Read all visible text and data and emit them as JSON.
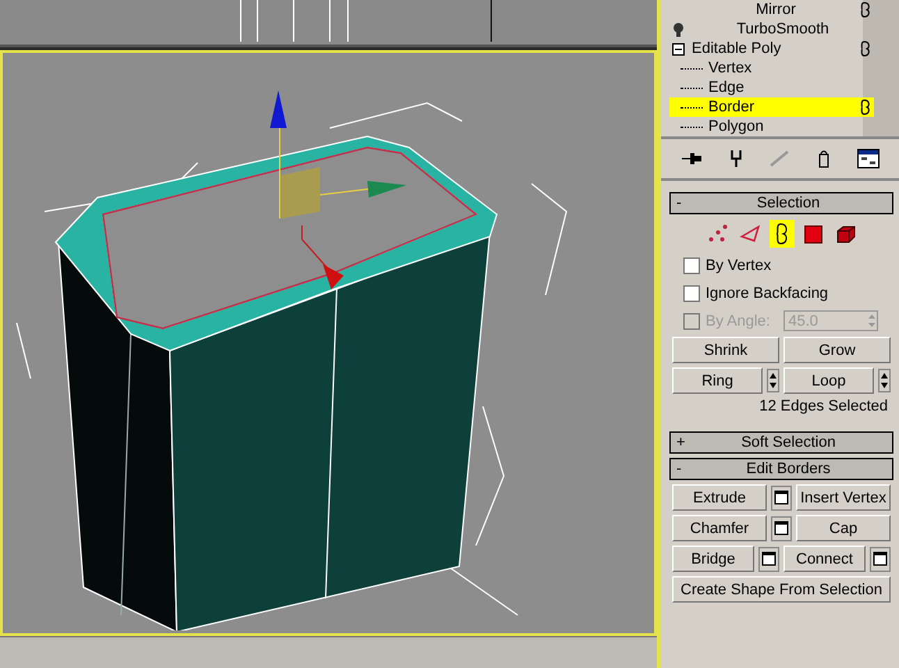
{
  "modifier_stack": [
    {
      "label": "Mirror",
      "kind": "modifier",
      "mode_icon": true,
      "selected": false
    },
    {
      "label": "TurboSmooth",
      "kind": "modifier",
      "mode_icon": false,
      "selected": false
    },
    {
      "label": "Editable Poly",
      "kind": "object",
      "mode_icon": true,
      "selected": false,
      "expanded": true,
      "children": [
        {
          "label": "Vertex",
          "mode_icon": false,
          "selected": false
        },
        {
          "label": "Edge",
          "mode_icon": false,
          "selected": false
        },
        {
          "label": "Border",
          "mode_icon": true,
          "selected": true
        },
        {
          "label": "Polygon",
          "mode_icon": false,
          "selected": false
        }
      ]
    }
  ],
  "selection": {
    "title": "Selection",
    "collapse_sign": "-",
    "levels": [
      {
        "kind": "vertex",
        "selected": false
      },
      {
        "kind": "edge",
        "selected": false
      },
      {
        "kind": "border",
        "selected": true
      },
      {
        "kind": "polygon",
        "selected": false
      },
      {
        "kind": "element",
        "selected": false
      }
    ],
    "options": [
      {
        "label": "By Vertex",
        "checked": false,
        "disabled": false
      },
      {
        "label": "Ignore Backfacing",
        "checked": false,
        "disabled": false
      },
      {
        "label": "By Angle:",
        "checked": false,
        "disabled": true,
        "value": "45.0"
      }
    ],
    "buttons": [
      [
        {
          "label": "Shrink",
          "spinner": false
        },
        {
          "label": "Grow",
          "spinner": false
        }
      ],
      [
        {
          "label": "Ring",
          "spinner": true
        },
        {
          "label": "Loop",
          "spinner": true
        }
      ]
    ],
    "status": "12 Edges Selected"
  },
  "soft_selection": {
    "title": "Soft Selection",
    "collapse_sign": "+"
  },
  "edit_borders": {
    "title": "Edit Borders",
    "collapse_sign": "-",
    "buttons": [
      [
        {
          "label": "Extrude",
          "settings": true
        },
        {
          "label": "Insert Vertex",
          "settings": false
        }
      ],
      [
        {
          "label": "Chamfer",
          "settings": true
        },
        {
          "label": "Cap",
          "settings": false
        }
      ],
      [
        {
          "label": "Bridge",
          "settings": true
        },
        {
          "label": "Connect",
          "settings": true
        }
      ]
    ],
    "wide_button": "Create Shape From Selection"
  }
}
